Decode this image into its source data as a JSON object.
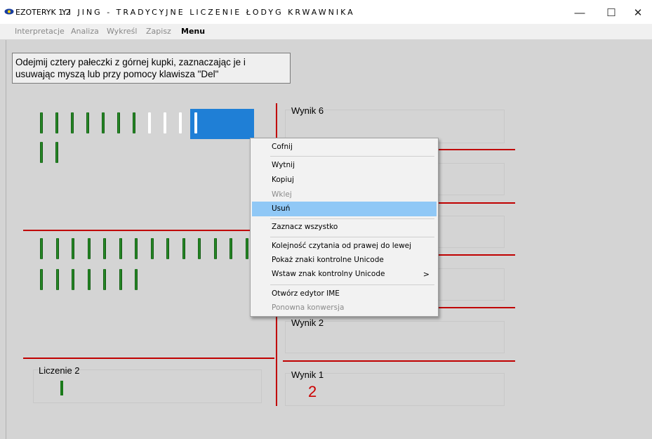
{
  "window": {
    "app_name": "EZOTERYK 1.2",
    "title": "YI JING - TRADYCYJNE LICZENIE ŁODYG KRWAWNIKA",
    "minimize": "—",
    "maximize": "☐",
    "close": "✕"
  },
  "menubar": {
    "items": [
      "Interpretacje",
      "Analiza",
      "Wykreśl",
      "Zapisz",
      "Menu"
    ],
    "active": "Menu"
  },
  "instruction": "Odejmij cztery pałeczki z górnej kupki, zaznaczając je i usuwając myszą lub przy pomocy klawisza \"Del\"",
  "sticks": {
    "top_pile": 13,
    "top_selected": 4,
    "bottom_pile": 21
  },
  "panels": {
    "wynik6": "Wynik 6",
    "wynik2": "Wynik 2",
    "wynik1": "Wynik 1",
    "wynik1_value": "2",
    "liczenie": "Liczenie 2"
  },
  "context_menu": {
    "items": [
      {
        "label": "Cofnij",
        "enabled": true
      },
      {
        "label": "Wytnij",
        "enabled": true
      },
      {
        "label": "Kopiuj",
        "enabled": true
      },
      {
        "label": "Wklej",
        "enabled": false
      },
      {
        "label": "Usuń",
        "enabled": true,
        "highlighted": true
      },
      {
        "label": "Zaznacz wszystko",
        "enabled": true
      },
      {
        "label": "Kolejność czytania od prawej do lewej",
        "enabled": true
      },
      {
        "label": "Pokaż znaki kontrolne Unicode",
        "enabled": true
      },
      {
        "label": "Wstaw znak kontrolny Unicode",
        "enabled": true,
        "submenu": true
      },
      {
        "label": "Otwórz edytor IME",
        "enabled": true
      },
      {
        "label": "Ponowna konwersja",
        "enabled": false
      }
    ],
    "submenu_arrow": ">"
  },
  "colors": {
    "accent_red": "#c00000",
    "selection_blue": "#1f7fd6",
    "highlight_blue": "#90c8f6",
    "stick_green": "#2e9a2e"
  }
}
